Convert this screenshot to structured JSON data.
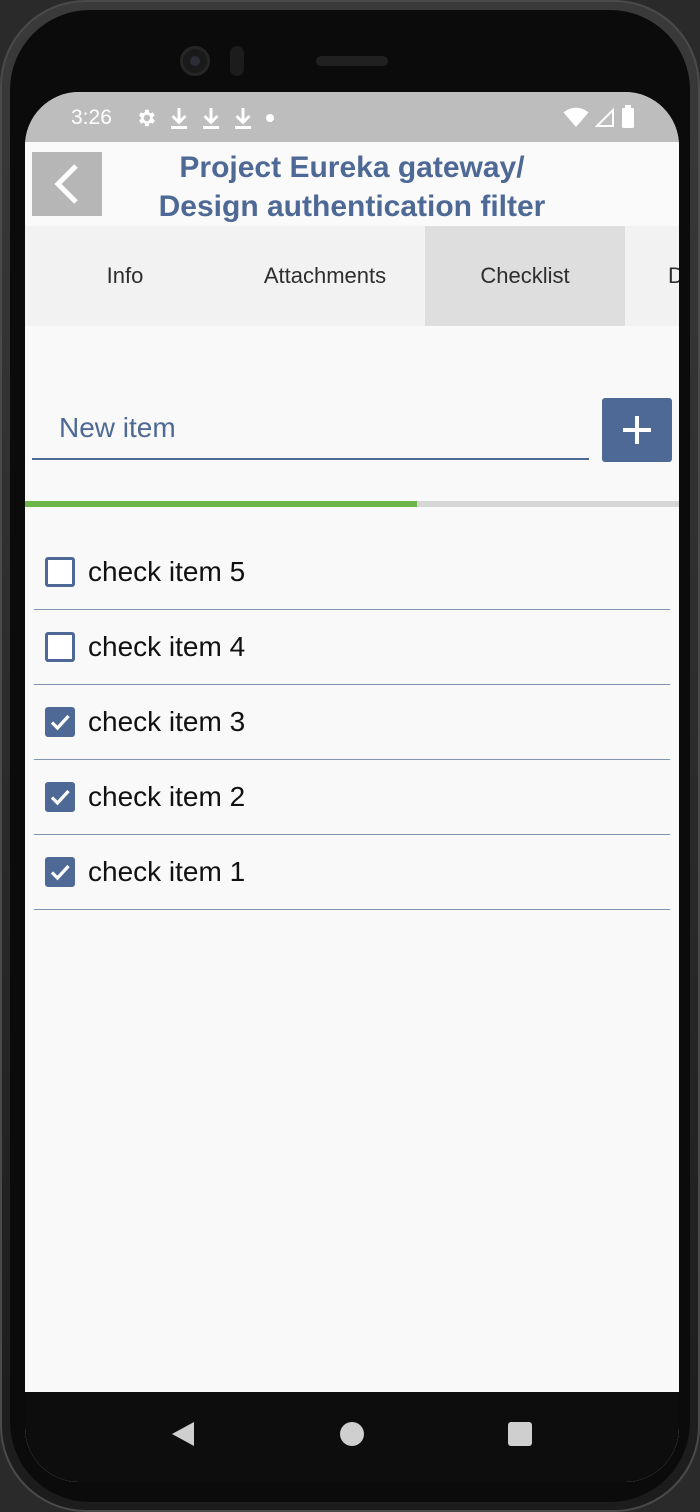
{
  "status_bar": {
    "time": "3:26",
    "icons_left": [
      "gear-icon",
      "download-icon",
      "download-icon",
      "download-icon",
      "dot-icon"
    ],
    "icons_right": [
      "wifi-icon",
      "signal-icon",
      "battery-icon"
    ]
  },
  "header": {
    "title_line1": "Project Eureka gateway/",
    "title_line2": "Design authentication filter",
    "back_icon": "chevron-left-icon"
  },
  "tabs": [
    {
      "label": "Info",
      "active": false
    },
    {
      "label": "Attachments",
      "active": false
    },
    {
      "label": "Checklist",
      "active": true
    },
    {
      "label": "D",
      "active": false
    }
  ],
  "new_item": {
    "placeholder": "New item",
    "value": "",
    "add_icon": "plus-icon"
  },
  "progress": {
    "completed": 3,
    "total": 5,
    "fraction": 0.6
  },
  "checklist": [
    {
      "label": "check item 5",
      "checked": false
    },
    {
      "label": "check item 4",
      "checked": false
    },
    {
      "label": "check item 3",
      "checked": true
    },
    {
      "label": "check item 2",
      "checked": true
    },
    {
      "label": "check item 1",
      "checked": true
    }
  ],
  "colors": {
    "accent": "#4e6995",
    "progress": "#6db64a",
    "status_bar": "#bdbdbd",
    "active_tab": "#dedede"
  },
  "nav_bar": {
    "icons": [
      "back-triangle-icon",
      "home-circle-icon",
      "recents-square-icon"
    ]
  }
}
